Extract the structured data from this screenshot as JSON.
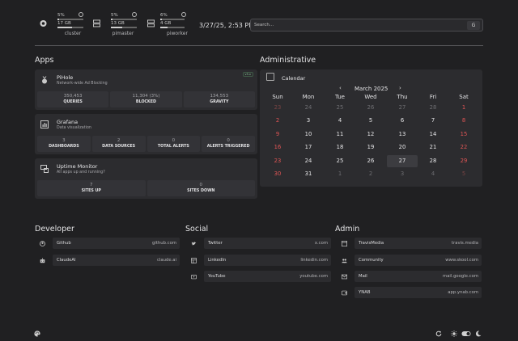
{
  "header": {
    "servers": [
      {
        "name": "cluster",
        "cpu": "5%",
        "cpu_level": 0.05,
        "ram": "17 GB",
        "ram_level": 0.55
      },
      {
        "name": "pimaster",
        "cpu": "5%",
        "cpu_level": 0.05,
        "ram": "13 GB",
        "ram_level": 0.45
      },
      {
        "name": "piworker",
        "cpu": "6%",
        "cpu_level": 0.06,
        "ram": "4 GB",
        "ram_level": 0.3
      }
    ],
    "datetime": "3/27/25, 2:53 PM",
    "search": {
      "placeholder": "Search...",
      "button": "G"
    }
  },
  "apps": {
    "title": "Apps",
    "pihole": {
      "name": "PiHole",
      "desc": "Network-wide Ad Blocking",
      "badge": "v5.x",
      "stats": [
        {
          "value": "350,453",
          "label": "QUERIES"
        },
        {
          "value": "11,304 (3%)",
          "label": "BLOCKED"
        },
        {
          "value": "134,553",
          "label": "GRAVITY"
        }
      ]
    },
    "grafana": {
      "name": "Grafana",
      "desc": "Data visualization",
      "stats": [
        {
          "value": "3",
          "label": "DASHBOARDS"
        },
        {
          "value": "2",
          "label": "DATA SOURCES"
        },
        {
          "value": "0",
          "label": "TOTAL ALERTS"
        },
        {
          "value": "0",
          "label": "ALERTS TRIGGERED"
        }
      ]
    },
    "uptime": {
      "name": "Uptime Monitor",
      "desc": "All apps up and running?",
      "stats": [
        {
          "value": "7",
          "label": "SITES UP"
        },
        {
          "value": "0",
          "label": "SITES DOWN"
        }
      ]
    }
  },
  "administrative": {
    "title": "Administrative",
    "calendar": {
      "title": "Calendar",
      "month": "March 2025",
      "prev": "‹",
      "next": "›",
      "weekdays": [
        "Sun",
        "Mon",
        "Tue",
        "Wed",
        "Thu",
        "Fri",
        "Sat"
      ],
      "weeks": [
        [
          "23",
          "24",
          "25",
          "26",
          "27",
          "28",
          "1"
        ],
        [
          "2",
          "3",
          "4",
          "5",
          "6",
          "7",
          "8"
        ],
        [
          "9",
          "10",
          "11",
          "12",
          "13",
          "14",
          "15"
        ],
        [
          "16",
          "17",
          "18",
          "19",
          "20",
          "21",
          "22"
        ],
        [
          "23",
          "24",
          "25",
          "26",
          "27",
          "28",
          "29"
        ],
        [
          "30",
          "31",
          "1",
          "2",
          "3",
          "4",
          "5"
        ]
      ],
      "today": "27"
    }
  },
  "developer": {
    "title": "Developer",
    "links": [
      {
        "name": "Github",
        "url": "github.com",
        "icon": "github-icon"
      },
      {
        "name": "ClaudeAI",
        "url": "claude.ai",
        "icon": "robot-icon"
      }
    ]
  },
  "social": {
    "title": "Social",
    "links": [
      {
        "name": "Twitter",
        "url": "x.com",
        "icon": "twitter-icon"
      },
      {
        "name": "LinkedIn",
        "url": "linkedin.com",
        "icon": "linkedin-icon"
      },
      {
        "name": "YouTube",
        "url": "youtube.com",
        "icon": "youtube-icon"
      }
    ]
  },
  "admin": {
    "title": "Admin",
    "links": [
      {
        "name": "TravisMedia",
        "url": "travis.media",
        "icon": "window-icon"
      },
      {
        "name": "Community",
        "url": "www.skool.com",
        "icon": "people-icon"
      },
      {
        "name": "Mail",
        "url": "mail.google.com",
        "icon": "mail-icon"
      },
      {
        "name": "YNAB",
        "url": "app.ynab.com",
        "icon": "wallet-icon"
      }
    ]
  },
  "colors": {
    "background": "#202022",
    "card": "#2c2c2f",
    "weekend": "#e05555"
  }
}
